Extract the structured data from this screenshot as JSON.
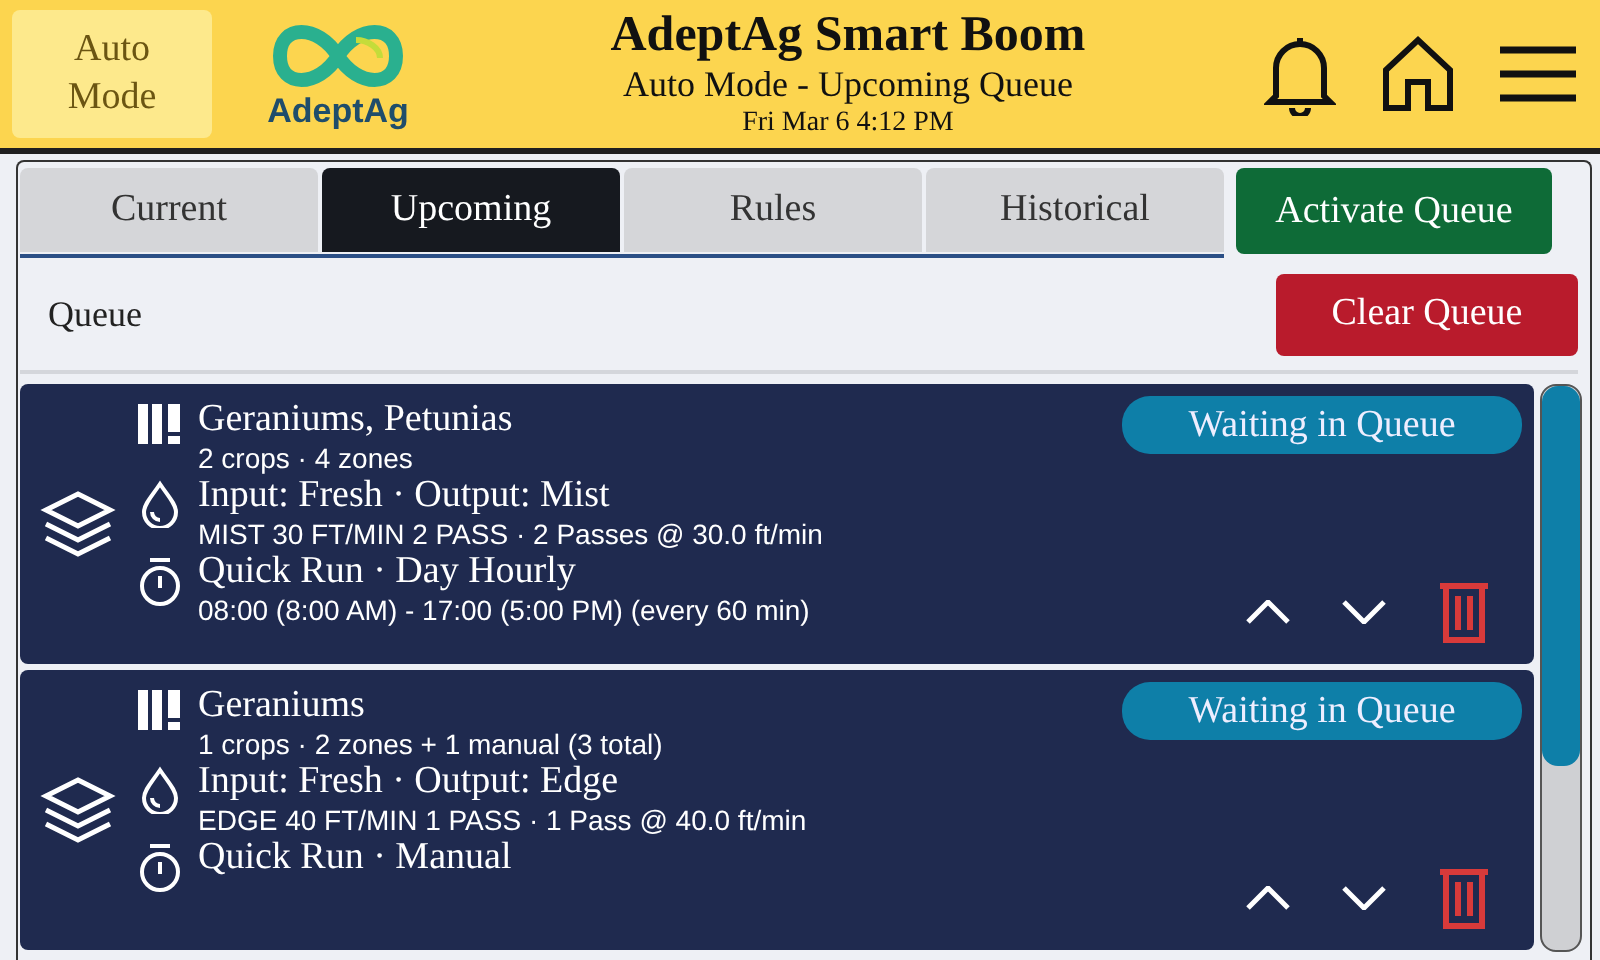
{
  "header": {
    "mode_button": "Auto\nMode",
    "logo_text": "AdeptAg",
    "title": "AdeptAg Smart Boom",
    "subtitle": "Auto Mode - Upcoming Queue",
    "datetime": "Fri Mar 6 4:12 PM"
  },
  "tabs": [
    {
      "label": "Current",
      "selected": false
    },
    {
      "label": "Upcoming",
      "selected": true
    },
    {
      "label": "Rules",
      "selected": false
    },
    {
      "label": "Historical",
      "selected": false
    }
  ],
  "activate_button": "Activate Queue",
  "queue": {
    "label": "Queue",
    "clear_button": "Clear Queue"
  },
  "items": [
    {
      "crops": "Geraniums, Petunias",
      "crops_detail": "2 crops · 4 zones",
      "water": "Input: Fresh · Output: Mist",
      "water_detail": "MIST 30 FT/MIN 2 PASS · 2 Passes @ 30.0 ft/min",
      "schedule": "Quick Run · Day Hourly",
      "schedule_detail": "08:00 (8:00 AM) - 17:00 (5:00 PM) (every 60 min)",
      "status": "Waiting in Queue"
    },
    {
      "crops": "Geraniums",
      "crops_detail": "1 crops · 2 zones + 1 manual (3 total)",
      "water": "Input: Fresh · Output: Edge",
      "water_detail": "EDGE 40 FT/MIN 1 PASS · 1 Pass @ 40.0 ft/min",
      "schedule": "Quick Run · Manual",
      "status": "Waiting in Queue"
    }
  ]
}
